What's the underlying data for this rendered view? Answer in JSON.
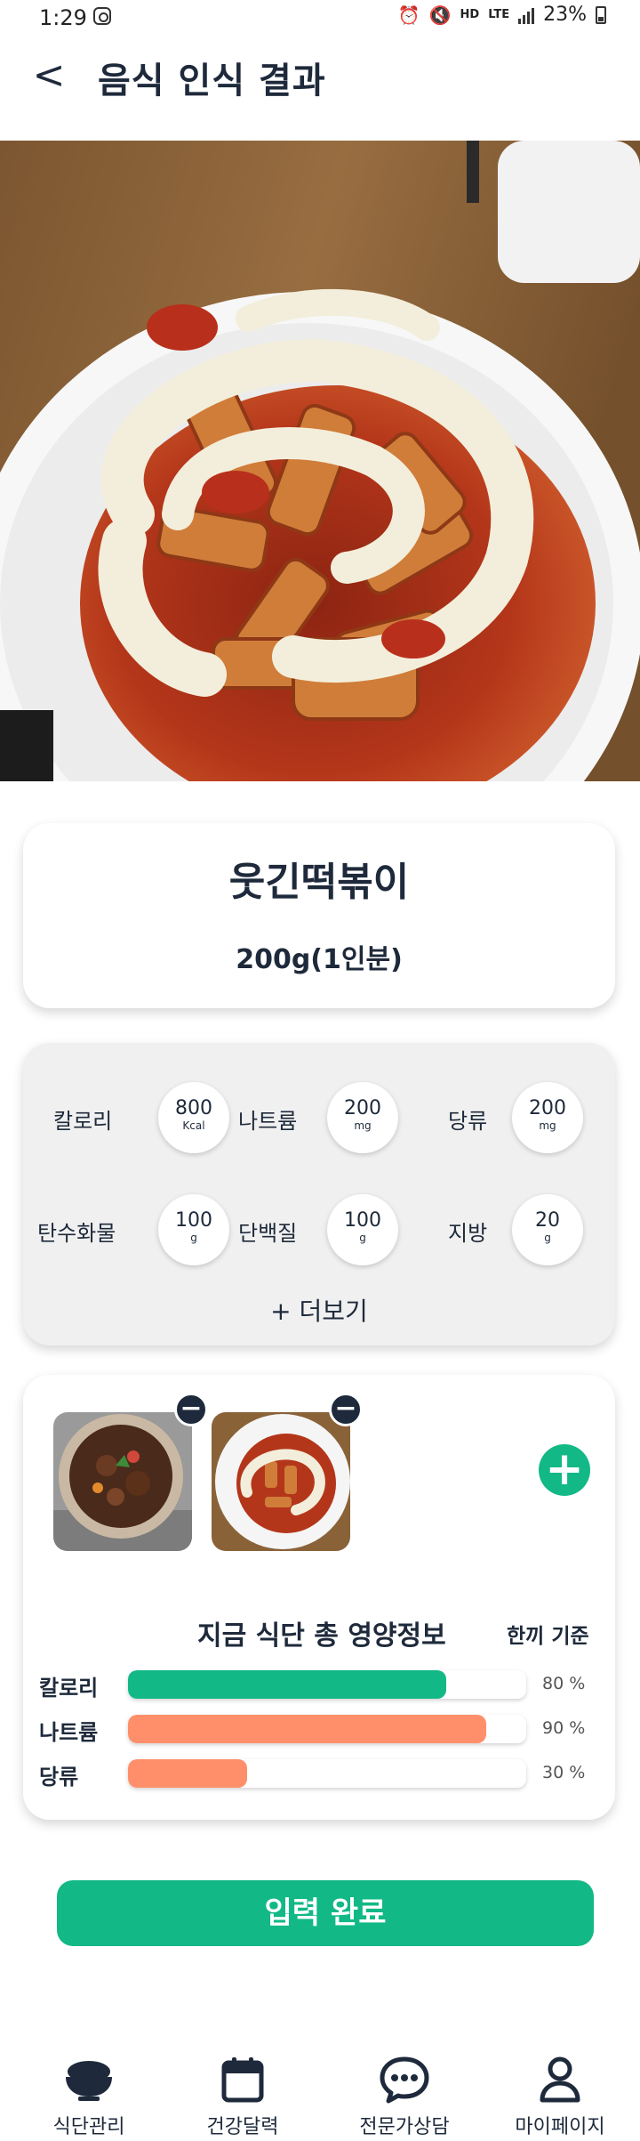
{
  "status_bar": {
    "time": "1:29",
    "network": "LTE",
    "hd_label": "HD",
    "battery": "23%",
    "icons": [
      "instagram-icon",
      "alarm-icon",
      "mute-icon",
      "signal-icon",
      "battery-icon"
    ]
  },
  "header": {
    "title": "음식 인식 결과",
    "back_icon": "chevron-left-icon"
  },
  "food": {
    "name": "웃긴떡볶이",
    "amount": "200g(1인분)"
  },
  "nutrients": [
    {
      "label": "칼로리",
      "value": "800",
      "unit": "Kcal"
    },
    {
      "label": "나트륨",
      "value": "200",
      "unit": "mg"
    },
    {
      "label": "당류",
      "value": "200",
      "unit": "mg"
    },
    {
      "label": "탄수화물",
      "value": "100",
      "unit": "g"
    },
    {
      "label": "단백질",
      "value": "100",
      "unit": "g"
    },
    {
      "label": "지방",
      "value": "20",
      "unit": "g"
    }
  ],
  "more_label": "+ 더보기",
  "meal": {
    "remove_symbol": "−",
    "add_symbol": "+",
    "summary_title": "지금 식단 총 영양정보",
    "basis": "한끼 기준",
    "bars": [
      {
        "label": "칼로리",
        "percent": 80,
        "percent_text": "80 %",
        "color": "#12b886"
      },
      {
        "label": "나트륨",
        "percent": 90,
        "percent_text": "90 %",
        "color": "#ff8f6b"
      },
      {
        "label": "당류",
        "percent": 30,
        "percent_text": "30 %",
        "color": "#ff8f6b"
      }
    ]
  },
  "submit_label": "입력 완료",
  "nav": [
    {
      "label": "식단관리",
      "icon": "rice-bowl-icon"
    },
    {
      "label": "건강달력",
      "icon": "calendar-icon"
    },
    {
      "label": "전문가상담",
      "icon": "chat-bubble-icon"
    },
    {
      "label": "마이페이지",
      "icon": "person-icon"
    }
  ],
  "colors": {
    "accent": "#12b886",
    "warning": "#ff8f6b",
    "text": "#1e2a3b"
  }
}
